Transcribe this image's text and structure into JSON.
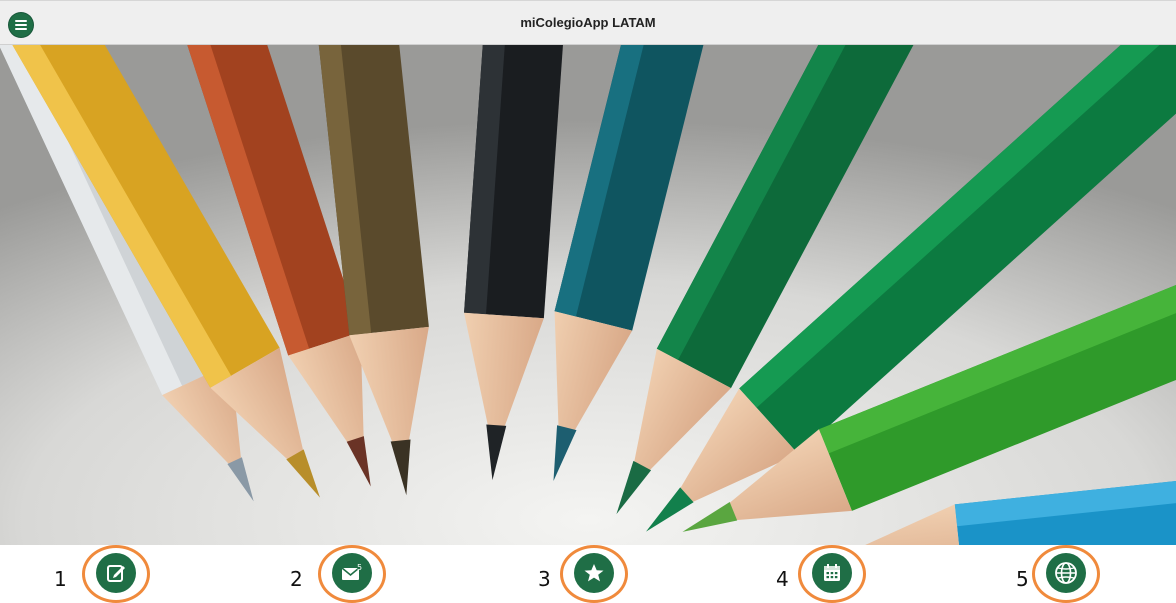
{
  "header": {
    "title": "miColegioApp LATAM",
    "menu_icon": "hamburger-menu-icon"
  },
  "hero": {
    "image": "colored-pencils-photo"
  },
  "colors": {
    "accent": "#1f6e46",
    "highlight_ring": "#f08a3c",
    "header_bg": "#efefef"
  },
  "bottom_nav": [
    {
      "number": "1",
      "icon": "edit-note-icon"
    },
    {
      "number": "2",
      "icon": "messages-icon"
    },
    {
      "number": "3",
      "icon": "star-icon"
    },
    {
      "number": "4",
      "icon": "calendar-icon"
    },
    {
      "number": "5",
      "icon": "globe-icon"
    }
  ]
}
